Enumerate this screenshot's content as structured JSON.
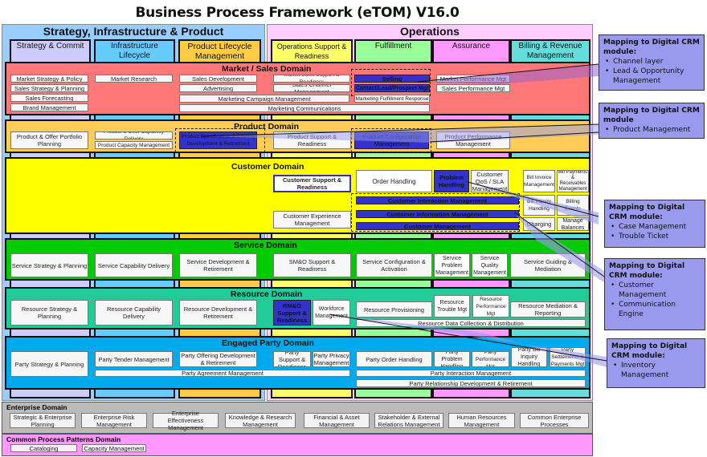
{
  "title": "Business Process Framework (eTOM) V16.0",
  "panels": {
    "sip": "Strategy, Infrastructure & Product",
    "ops": "Operations"
  },
  "vertical_groupings": [
    {
      "label": "Strategy & Commit",
      "color": "#ccccff"
    },
    {
      "label": "Infrastructure Lifecycle Management",
      "color": "#66ccff"
    },
    {
      "label": "Product Lifecycle Management",
      "color": "#ffcc44"
    },
    {
      "label": "Operations Support & Readiness",
      "color": "#ffff66"
    },
    {
      "label": "Fulfillment",
      "color": "#99ff99"
    },
    {
      "label": "Assurance",
      "color": "#ff99ff"
    },
    {
      "label": "Billing & Revenue Management",
      "color": "#66dddd"
    }
  ],
  "domains": {
    "market": {
      "title": "Market / Sales Domain",
      "color": "#ff7777",
      "items": {
        "strategy_policy": "Market Strategy & Policy",
        "sales_strategy": "Sales Strategy & Planning",
        "forecasting": "Sales Forecasting",
        "brand": "Brand Management",
        "research": "Market Research",
        "sales_dev": "Sales Development",
        "advertising": "Advertising",
        "campaign": "Marketing Campaign Management",
        "communications": "Marketing Communications",
        "ms_support": "Market Sales Support & Readiness",
        "channel": "Sales Channel Management",
        "selling": "Selling",
        "contact": "Contact/Lead/Prospect Mgt",
        "fulfillment_resp": "Marketing Fulfillment Response",
        "market_perf": "Market Performance Mgt",
        "sales_perf": "Sales Performance Mgt"
      }
    },
    "product": {
      "title": "Product Domain",
      "color": "#ffcc55",
      "items": {
        "portfolio": "Product & Offer Portfolio Planning",
        "capability": "Product & Offer Capability Delivery",
        "capacity": "Product Capacity Management",
        "spec": "Product Specification & Offering Development & Retirement",
        "support": "Product Support & Readiness",
        "config": "Product Configuration Management",
        "performance": "Product Performance Management"
      }
    },
    "customer": {
      "title": "Customer Domain",
      "color": "#ffff00",
      "items": {
        "support": "Customer Support & Readiness",
        "experience": "Customer Experience Management",
        "order": "Order Handling",
        "problem": "Problem Handling",
        "qos": "Customer QoS / SLA Management",
        "interaction": "Customer Interaction Management",
        "information": "Customer Information Management",
        "management": "Customer Management",
        "bill_invoice": "Bill Invoice Management",
        "bill_payments": "Bill Payments & Receivables Management",
        "bill_inquiry": "Bill Inquiry Handling",
        "billing_events": "Billing Events",
        "charging": "Charging",
        "balances": "Manage Balances"
      }
    },
    "service": {
      "title": "Service Domain",
      "color": "#00cc00",
      "items": {
        "strategy": "Service Strategy & Planning",
        "capability": "Service Capability Delivery",
        "development": "Service Development & Retirement",
        "smo": "SM&O Support & Readiness",
        "config": "Service Configuration & Activation",
        "problem": "Service Problem Management",
        "quality": "Service Quality Management",
        "guiding": "Service Guiding & Mediation"
      }
    },
    "resource": {
      "title": "Resource Domain",
      "color": "#22cc99",
      "items": {
        "strategy": "Resource Strategy & Planning",
        "capability": "Resource Capability Delivery",
        "development": "Resource  Development & Retirement",
        "rmo": "RM&O Support & Readiness",
        "workforce": "Workforce Management",
        "provisioning": "Resource Provisioning",
        "trouble": "Resource Trouble Mgt",
        "performance": "Resource Performance Mgt",
        "mediation": "Resource Mediation & Reporting",
        "data": "Resource Data Collection & Distribution"
      }
    },
    "party": {
      "title": "Engaged Party Domain",
      "color": "#00aaee",
      "items": {
        "strategy": "Party Strategy & Planning",
        "tender": "Party Tender Management",
        "offering": "Party Offering Development & Retirement",
        "support": "Party Support & Readiness",
        "privacy": "Party Privacy Management",
        "agreement": "Party Agreement Management",
        "order": "Party Order Handling",
        "problem": "Party Problem Handling",
        "performance": "Party Performance Mgt",
        "bill_inquiry": "Party Bill Inquiry Handling",
        "settlements": "Party Settlements & Payments Mgt",
        "interaction": "Party Interaction Management",
        "relationship": "Party Relationship Development & Retirement"
      }
    }
  },
  "enterprise": {
    "title": "Enterprise Domain",
    "items": [
      "Strategic & Enterprise Planning",
      "Enterprise Risk Management",
      "Enterprise Effectiveness Management",
      "Knowledge & Research Management",
      "Financial & Asset Management",
      "Stakeholder & External Relations Management",
      "Human Resources Management",
      "Common Enterprise Processes"
    ]
  },
  "common_patterns": {
    "title": "Common Process Patterns Domain",
    "items": [
      "Cataloging",
      "Capacity Management"
    ]
  },
  "callouts": [
    {
      "heading": "Mapping to Digital CRM module:",
      "bullets": [
        "Channel layer",
        "Lead & Opportunity Management"
      ]
    },
    {
      "heading": "Mapping to Digital CRM module",
      "bullets": [
        "Product Management"
      ]
    },
    {
      "heading": "Mapping to Digital CRM module:",
      "bullets": [
        "Case Management",
        "Trouble Ticket"
      ]
    },
    {
      "heading": "Mapping to Digital CRM module:",
      "bullets": [
        "Customer Management",
        "Communication Engine"
      ]
    },
    {
      "heading": "Mapping to Digital CRM module:",
      "bullets": [
        "Inventory Management"
      ]
    }
  ]
}
